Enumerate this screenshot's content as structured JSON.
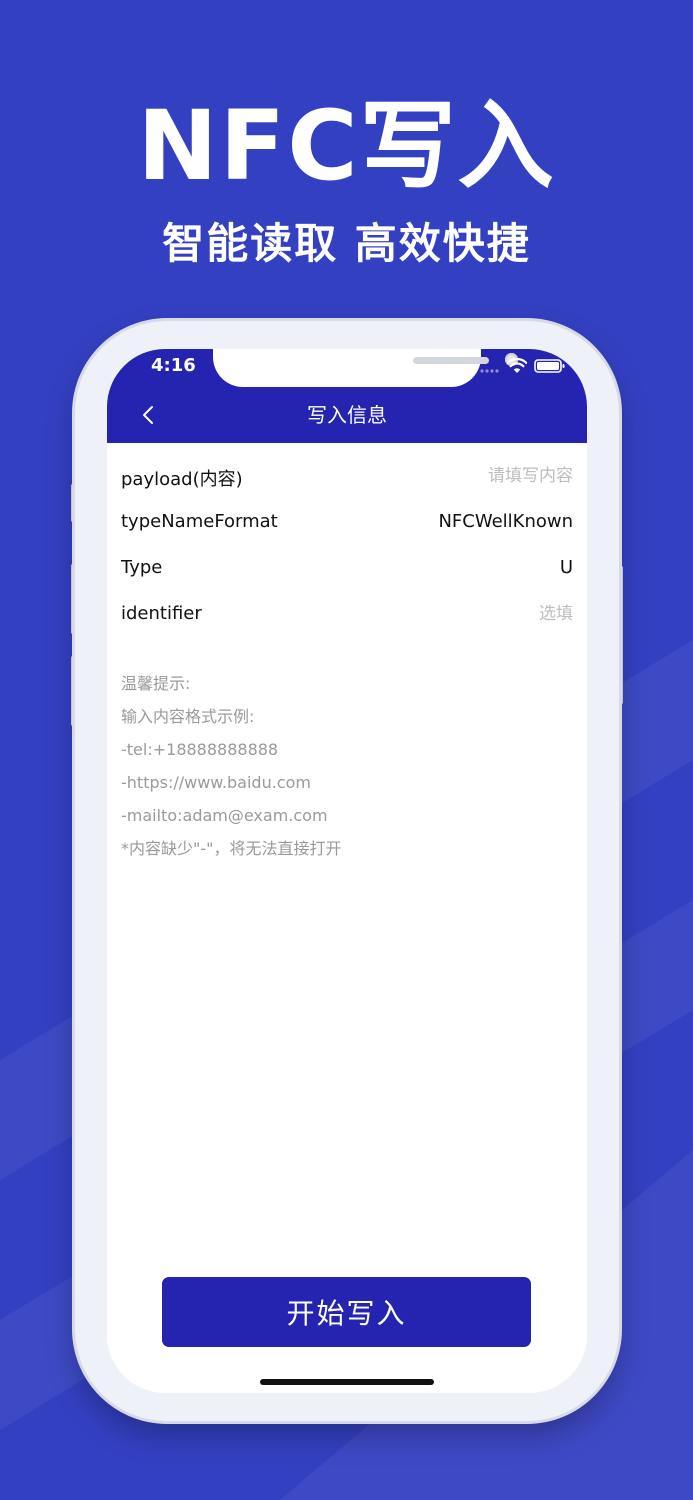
{
  "hero": {
    "title": "NFC写入",
    "subtitle": "智能读取 高效快捷"
  },
  "status_bar": {
    "time": "4:16"
  },
  "nav": {
    "title": "写入信息",
    "back_icon": "chevron-left-icon"
  },
  "fields": [
    {
      "label": "payload(内容)",
      "placeholder": "请填写内容",
      "value": ""
    },
    {
      "label": "typeNameFormat",
      "value": "NFCWellKnown"
    },
    {
      "label": "Type",
      "value": "U"
    },
    {
      "label": "identifier",
      "placeholder": "选填",
      "value": ""
    }
  ],
  "tips": [
    "温馨提示:",
    "输入内容格式示例:",
    "-tel:+18888888888",
    "-https://www.baidu.com",
    "-mailto:adam@exam.com",
    "*内容缺少\"-\"，将无法直接打开"
  ],
  "action": {
    "start_label": "开始写入"
  },
  "colors": {
    "background": "#3440c2",
    "primary": "#2524b0",
    "placeholder": "#bdbdbd",
    "tip_text": "#9a9a9a"
  }
}
